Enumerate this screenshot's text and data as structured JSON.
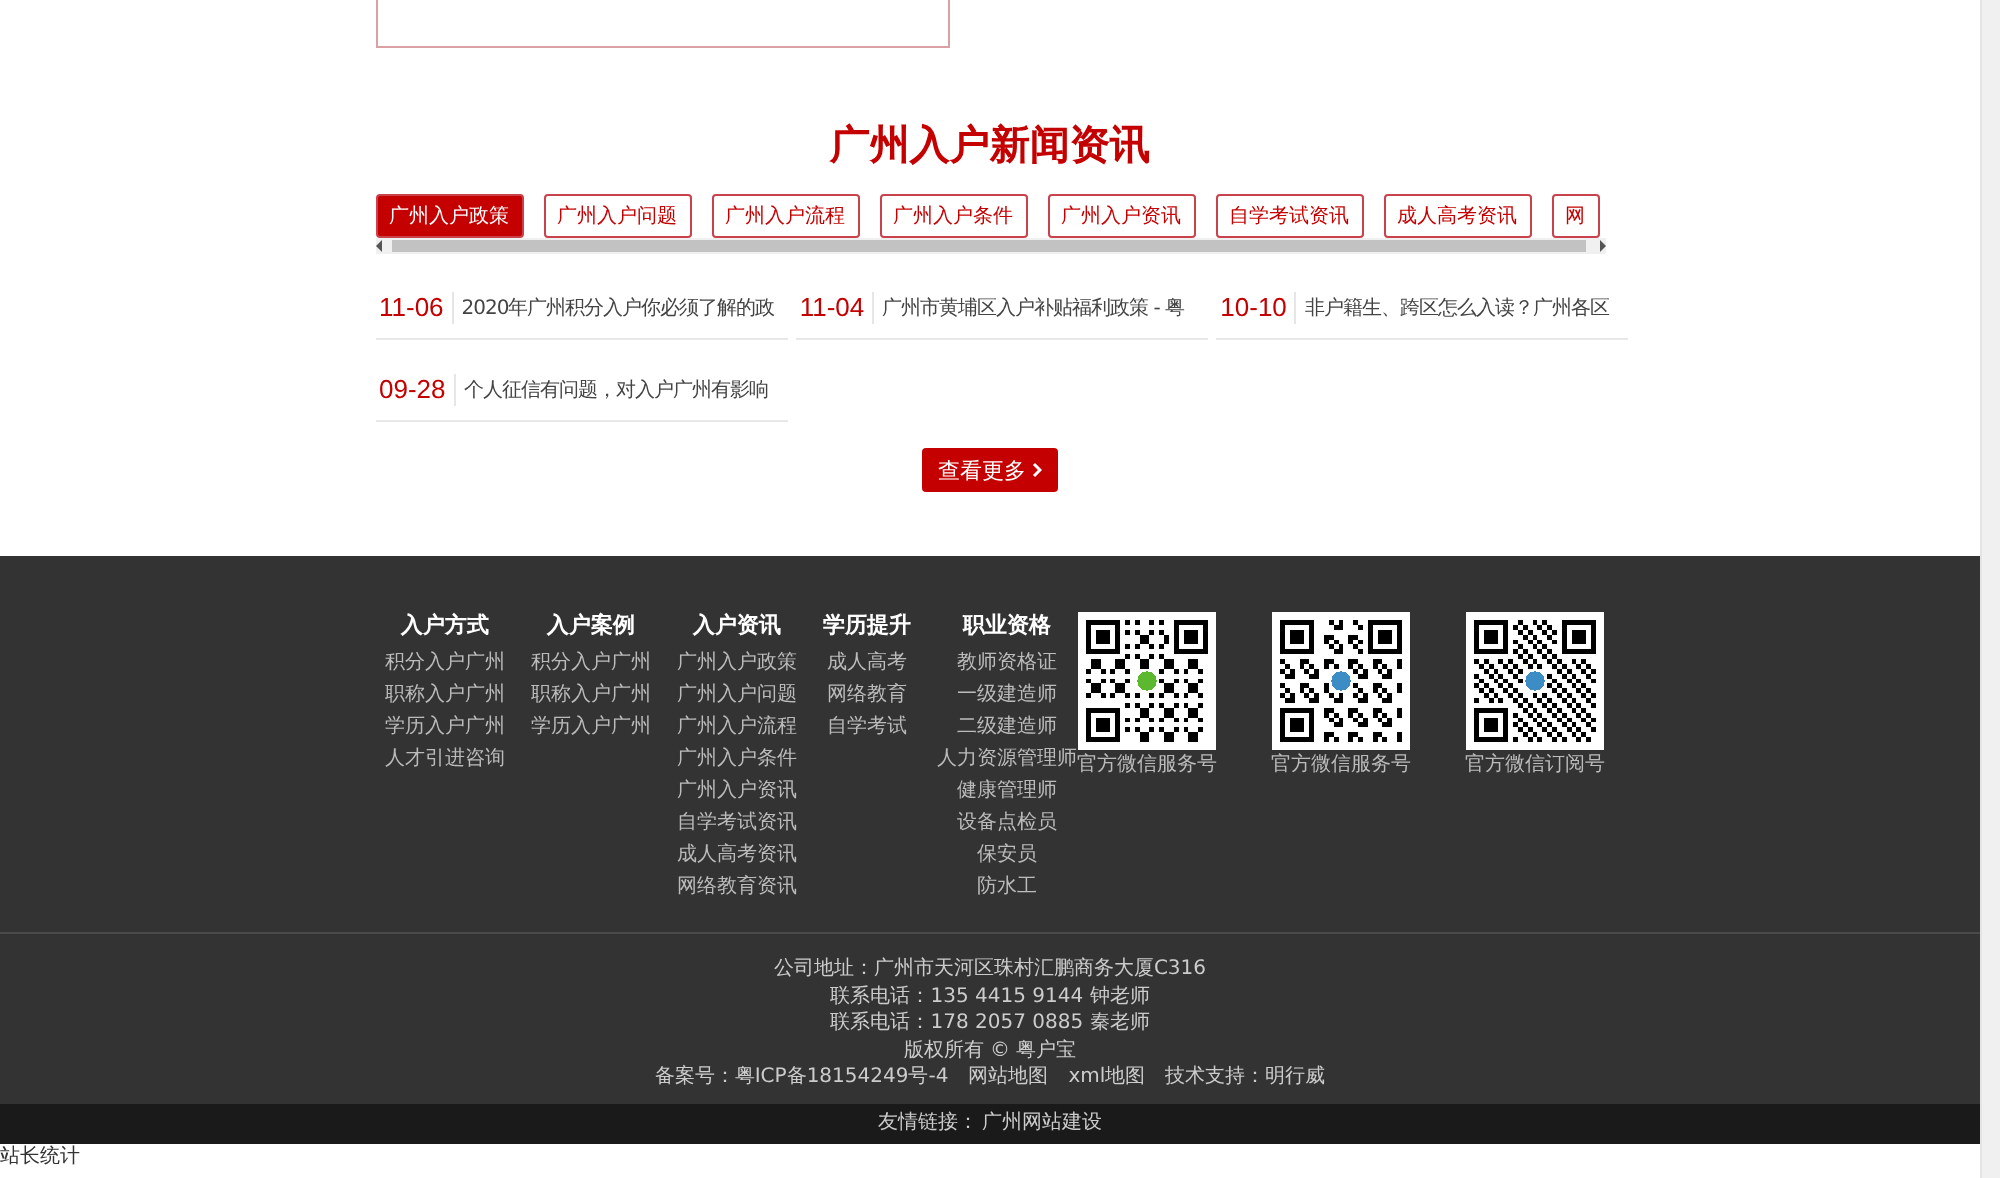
{
  "section_title": "广州入户新闻资讯",
  "tabs": [
    {
      "label": "广州入户政策",
      "selected": true
    },
    {
      "label": "广州入户问题",
      "selected": false
    },
    {
      "label": "广州入户流程",
      "selected": false
    },
    {
      "label": "广州入户条件",
      "selected": false
    },
    {
      "label": "广州入户资讯",
      "selected": false
    },
    {
      "label": "自学考试资讯",
      "selected": false
    },
    {
      "label": "成人高考资讯",
      "selected": false
    },
    {
      "label": "网",
      "selected": false
    }
  ],
  "news": [
    {
      "date": "11-06",
      "title": "2020年广州积分入户你必须了解的政"
    },
    {
      "date": "11-04",
      "title": "广州市黄埔区入户补贴福利政策 - 粤"
    },
    {
      "date": "10-10",
      "title": "非户籍生、跨区怎么入读？广州各区"
    },
    {
      "date": "09-28",
      "title": "个人征信有问题，对入户广州有影响"
    }
  ],
  "more_button": {
    "label": "查看更多"
  },
  "footer": {
    "columns": [
      {
        "heading": "入户方式",
        "links": [
          "积分入户广州",
          "职称入户广州",
          "学历入户广州",
          "人才引进咨询"
        ]
      },
      {
        "heading": "入户案例",
        "links": [
          "积分入户广州",
          "职称入户广州",
          "学历入户广州"
        ]
      },
      {
        "heading": "入户资讯",
        "links": [
          "广州入户政策",
          "广州入户问题",
          "广州入户流程",
          "广州入户条件",
          "广州入户资讯",
          "自学考试资讯",
          "成人高考资讯",
          "网络教育资讯"
        ]
      },
      {
        "heading": "学历提升",
        "links": [
          "成人高考",
          "网络教育",
          "自学考试"
        ]
      },
      {
        "heading": "职业资格",
        "links": [
          "教师资格证",
          "一级建造师",
          "二级建造师",
          "人力资源管理师",
          "健康管理师",
          "设备点检员",
          "保安员",
          "防水工"
        ]
      }
    ],
    "qr_codes": [
      {
        "caption": "官方微信服务号"
      },
      {
        "caption": "官方微信服务号"
      },
      {
        "caption": "官方微信订阅号"
      }
    ],
    "info_lines": [
      "公司地址：广州市天河区珠村汇鹏商务大厦C316",
      "联系电话：135 4415 9144 钟老师",
      "联系电话：178 2057 0885 秦老师",
      "版权所有 © 粤户宝"
    ],
    "record_links": [
      "备案号：粤ICP备18154249号-4",
      "网站地图",
      "xml地图",
      "技术支持：明行威"
    ],
    "friend_links": {
      "label": "友情链接：",
      "links": [
        "广州网站建设"
      ]
    }
  },
  "stats_link": "站长统计"
}
